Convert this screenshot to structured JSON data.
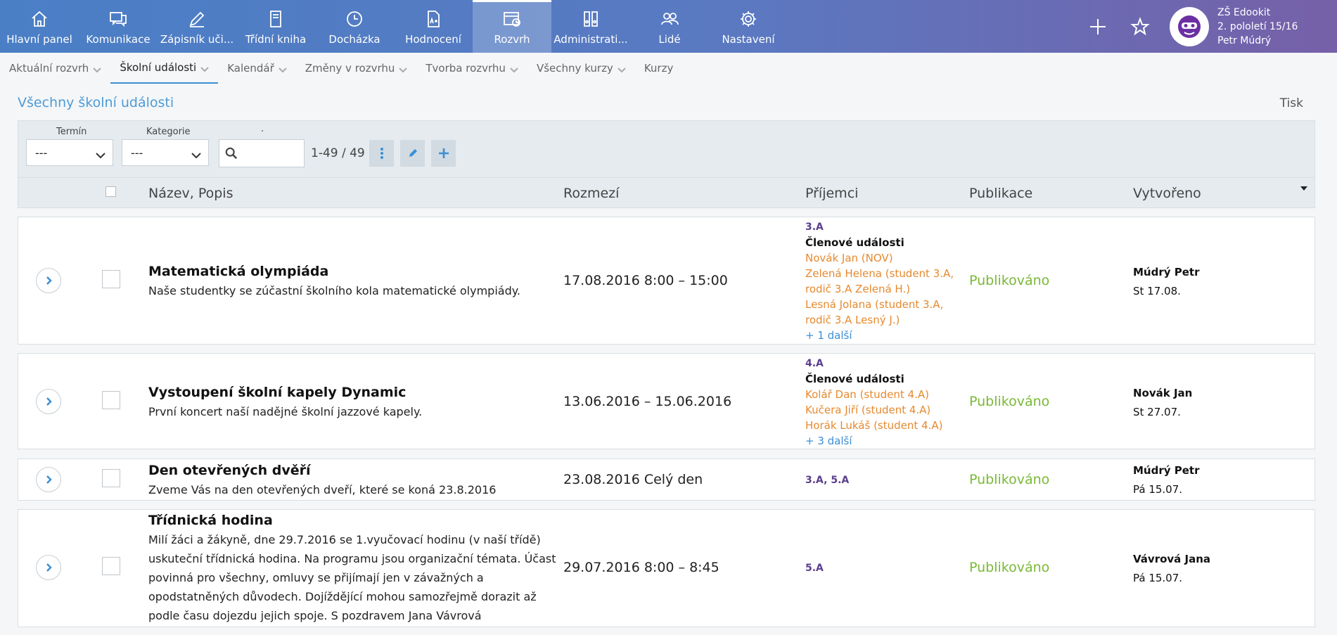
{
  "nav": {
    "items": [
      {
        "label": "Hlavní panel",
        "icon": "home-icon"
      },
      {
        "label": "Komunikace",
        "icon": "chat-icon"
      },
      {
        "label": "Zápisník uči...",
        "icon": "pencil-icon"
      },
      {
        "label": "Třídní kniha",
        "icon": "book-icon"
      },
      {
        "label": "Docházka",
        "icon": "clock-icon"
      },
      {
        "label": "Hodnocení",
        "icon": "grade-document-icon"
      },
      {
        "label": "Rozvrh",
        "icon": "schedule-icon"
      },
      {
        "label": "Administrati...",
        "icon": "binders-icon"
      },
      {
        "label": "Lidé",
        "icon": "people-icon"
      },
      {
        "label": "Nastavení",
        "icon": "gear-icon"
      }
    ],
    "active": "Rozvrh"
  },
  "user": {
    "school": "ZŠ Edookit",
    "term": "2. pololetí 15/16",
    "name": "Petr Múdrý"
  },
  "subnav": {
    "items": [
      {
        "label": "Aktuální rozvrh",
        "chevron": true
      },
      {
        "label": "Školní události",
        "chevron": true
      },
      {
        "label": "Kalendář",
        "chevron": true
      },
      {
        "label": "Změny v rozvrhu",
        "chevron": true
      },
      {
        "label": "Tvorba rozvrhu",
        "chevron": true
      },
      {
        "label": "Všechny kurzy",
        "chevron": true
      },
      {
        "label": "Kurzy",
        "chevron": false
      }
    ],
    "active": "Školní události"
  },
  "page": {
    "title": "Všechny školní události",
    "print": "Tisk"
  },
  "filters": {
    "term_label": "Termín",
    "term_value": "---",
    "category_label": "Kategorie",
    "category_value": "---",
    "search_label": ".",
    "search_value": "",
    "count": "1-49 / 49"
  },
  "table": {
    "columns": {
      "name": "Název, Popis",
      "range": "Rozmezí",
      "recipients": "Příjemci",
      "publication": "Publikace",
      "created": "Vytvořeno"
    },
    "rows": [
      {
        "title": "Matematická olympiáda",
        "desc": "Naše studentky se zúčastní školního kola matematické olympiády.",
        "range": "17.08.2016 8:00 – 15:00",
        "rec_class": "3.A",
        "rec_group": "Členové události",
        "rec_people": [
          "Novák Jan (NOV)",
          "Zelená Helena  (student 3.A, rodič 3.A Zelená H.)",
          "Lesná Jolana  (student 3.A, rodič 3.A Lesný J.)"
        ],
        "rec_more": "+ 1 další",
        "publication": "Publikováno",
        "author": "Múdrý Petr",
        "created": "St 17.08."
      },
      {
        "title": "Vystoupení školní kapely Dynamic",
        "desc": "První koncert naší nadějné školní jazzové kapely.",
        "range": "13.06.2016 – 15.06.2016",
        "rec_class": "4.A",
        "rec_group": "Členové události",
        "rec_people": [
          "Kolář Dan  (student 4.A)",
          "Kučera Jiří  (student 4.A)",
          "Horák Lukáš  (student 4.A)"
        ],
        "rec_more": "+ 3 další",
        "publication": "Publikováno",
        "author": "Novák Jan",
        "created": "St 27.07."
      },
      {
        "title": "Den otevřených dvěří",
        "desc": "Zveme Vás na den otevřených dveří, které se koná 23.8.2016",
        "range": "23.08.2016 Celý den",
        "rec_class": "3.A, 5.A",
        "publication": "Publikováno",
        "author": "Múdrý Petr",
        "created": "Pá 15.07."
      },
      {
        "title": "Třídnická hodina",
        "desc": "Milí žáci a žákyně, dne 29.7.2016 se 1.vyučovací hodinu (v naší třídě) uskuteční třídnická hodina. Na programu jsou organizační témata. Účast povinná pro všechny, omluvy se přijímají jen v závažných a opodstatněných důvodech. Dojíždějící mohou samozřejmě dorazit až podle času dojezdu jejich spoje.   S pozdravem Jana Vávrová",
        "range": "29.07.2016 8:00 – 8:45",
        "rec_class": "5.A",
        "publication": "Publikováno",
        "author": "Vávrová Jana",
        "created": "Pá 15.07."
      }
    ]
  },
  "colors": {
    "accent": "#3b8fd6",
    "published": "#7ab836",
    "person": "#e6892e",
    "class": "#5b3f8e"
  }
}
